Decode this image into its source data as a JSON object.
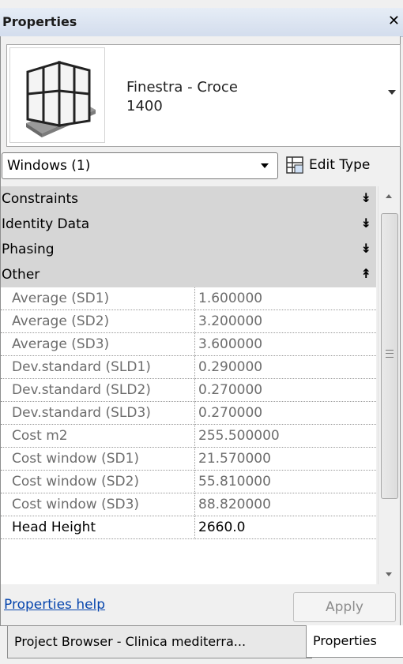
{
  "window": {
    "title": "Properties",
    "close_glyph": "✕"
  },
  "type_selector": {
    "family": "Finestra - Croce",
    "type": "1400",
    "thumbnail_icon": "window-thumbnail-icon"
  },
  "instance_filter": {
    "value": "Windows (1)"
  },
  "edit_type": {
    "label": "Edit Type",
    "icon": "edit-type-icon"
  },
  "groups": [
    {
      "label": "Constraints",
      "chevron": "»",
      "expanded": false
    },
    {
      "label": "Identity Data",
      "chevron": "»",
      "expanded": false
    },
    {
      "label": "Phasing",
      "chevron": "»",
      "expanded": false
    },
    {
      "label": "Other",
      "chevron": "«",
      "expanded": true
    }
  ],
  "rows": [
    {
      "name": "Average (SD1)",
      "value": "1.600000"
    },
    {
      "name": "Average (SD2)",
      "value": "3.200000"
    },
    {
      "name": "Average (SD3)",
      "value": "3.600000"
    },
    {
      "name": "Dev.standard (SLD1)",
      "value": "0.290000"
    },
    {
      "name": "Dev.standard (SLD2)",
      "value": "0.270000"
    },
    {
      "name": "Dev.standard (SLD3)",
      "value": "0.270000"
    },
    {
      "name": "Cost m2",
      "value": "255.500000"
    },
    {
      "name": "Cost window (SD1)",
      "value": "21.570000"
    },
    {
      "name": "Cost window (SD2)",
      "value": "55.810000"
    },
    {
      "name": "Cost window (SD3)",
      "value": "88.820000"
    },
    {
      "name": "Head Height",
      "value": "2660.0"
    }
  ],
  "footer": {
    "help_link": "Properties help",
    "apply_label": "Apply"
  },
  "tabs": [
    {
      "label": "Project Browser - Clinica mediterra..."
    },
    {
      "label": "Properties"
    }
  ]
}
